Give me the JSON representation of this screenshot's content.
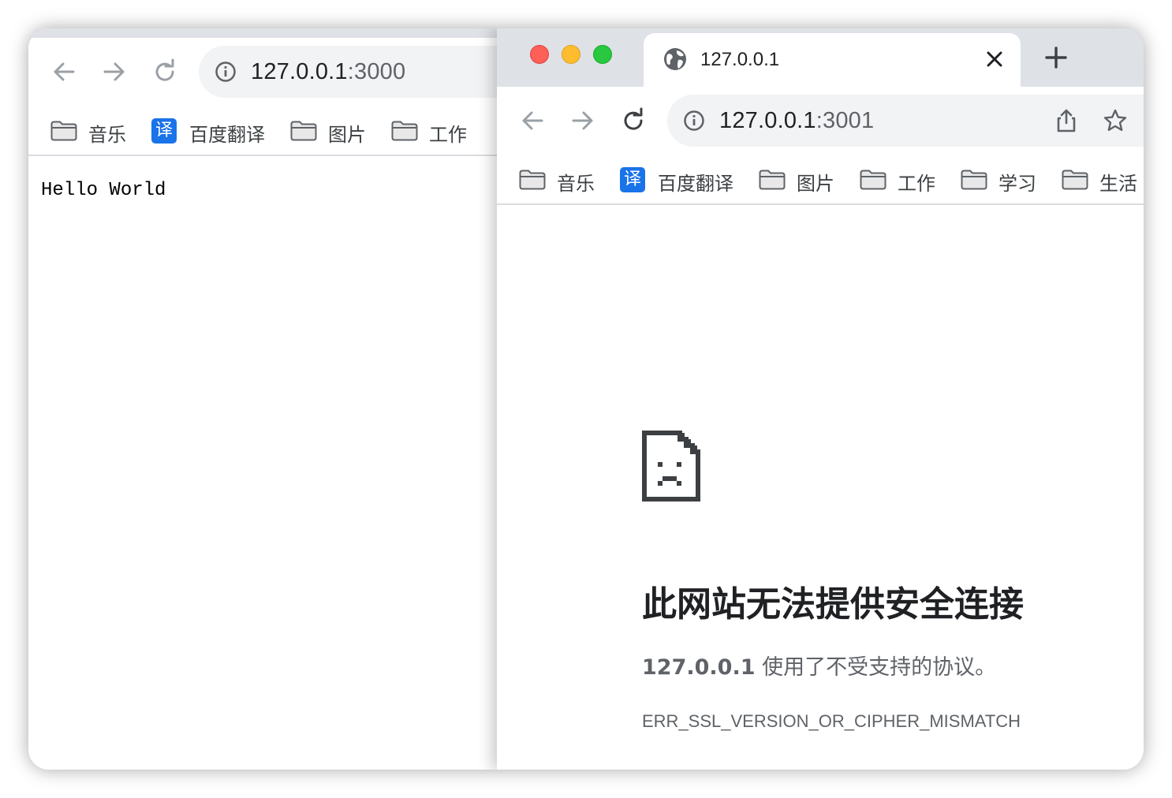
{
  "back_window": {
    "url_host": "127.0.0.1",
    "url_port": ":3000",
    "page_text": "Hello World",
    "bookmarks": [
      {
        "label": "音乐",
        "icon": "folder-icon"
      },
      {
        "label": "百度翻译",
        "icon": "translate-icon",
        "badge": "译"
      },
      {
        "label": "图片",
        "icon": "folder-icon"
      },
      {
        "label": "工作",
        "icon": "folder-icon"
      }
    ]
  },
  "front_window": {
    "tab_title": "127.0.0.1",
    "url_host": "127.0.0.1",
    "url_port": ":3001",
    "bookmarks": [
      {
        "label": "音乐",
        "icon": "folder-icon"
      },
      {
        "label": "百度翻译",
        "icon": "translate-icon",
        "badge": "译"
      },
      {
        "label": "图片",
        "icon": "folder-icon"
      },
      {
        "label": "工作",
        "icon": "folder-icon"
      },
      {
        "label": "学习",
        "icon": "folder-icon"
      },
      {
        "label": "生活",
        "icon": "folder-icon"
      }
    ],
    "error": {
      "title": "此网站无法提供安全连接",
      "host": "127.0.0.1",
      "description": " 使用了不受支持的协议。",
      "code": "ERR_SSL_VERSION_OR_CIPHER_MISMATCH"
    }
  },
  "colors": {
    "tabbar_bg": "#dee1e6",
    "omnibox_bg": "#f1f3f4",
    "translate_badge": "#1a73e8",
    "traffic_red": "#fe5f57",
    "traffic_yellow": "#febc2e",
    "traffic_green": "#28c840"
  }
}
